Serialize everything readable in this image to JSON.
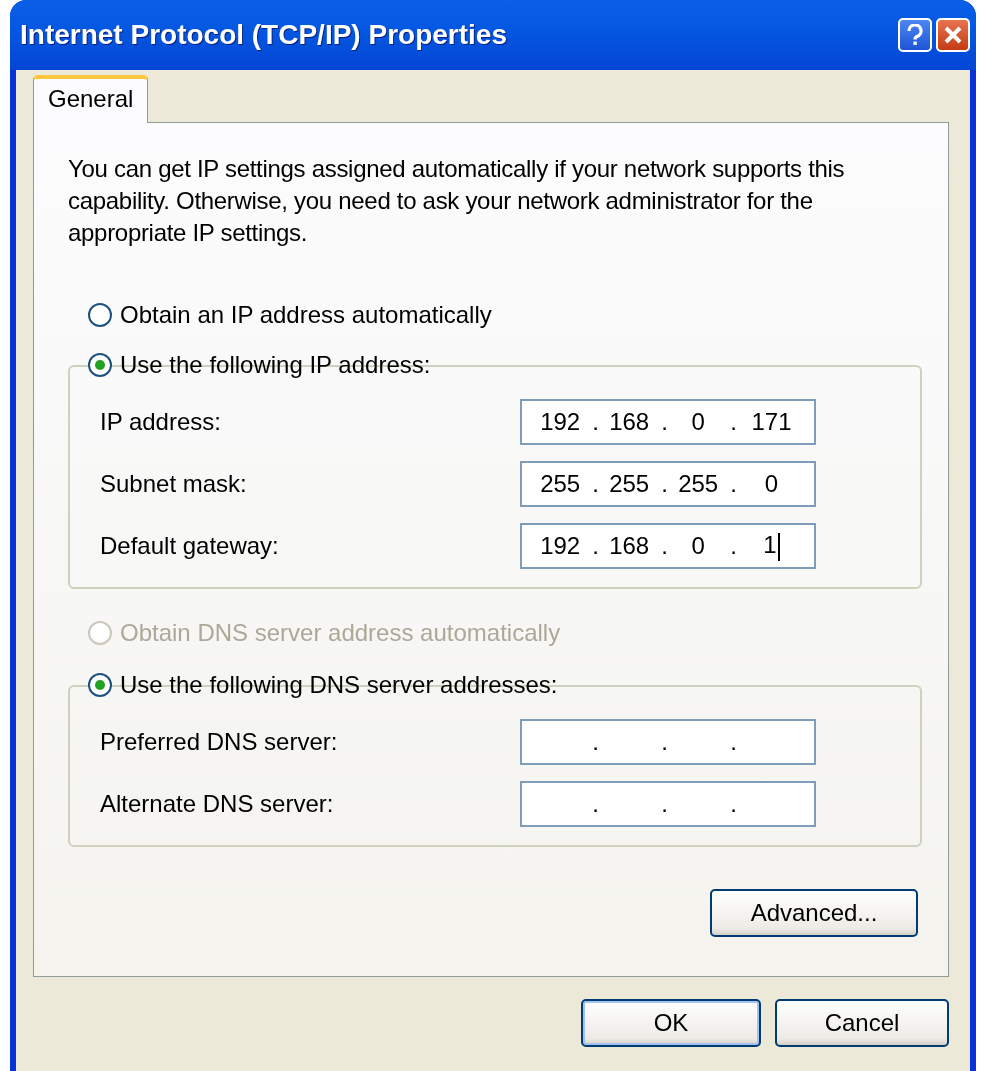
{
  "window": {
    "title": "Internet Protocol (TCP/IP) Properties"
  },
  "tabs": [
    {
      "label": "General",
      "selected": true
    }
  ],
  "intro": "You can get IP settings assigned automatically if your network supports this capability. Otherwise, you need to ask your network administrator for the appropriate IP settings.",
  "ip_options": [
    {
      "label": "Obtain an IP address automatically",
      "selected": false,
      "disabled": false
    },
    {
      "label": "Use the following IP address:",
      "selected": true,
      "disabled": false
    }
  ],
  "ip_fields": [
    {
      "label": "IP address:",
      "octets": [
        "192",
        "168",
        "0",
        "171"
      ],
      "dots": [
        ".",
        ".",
        "."
      ],
      "focused": false
    },
    {
      "label": "Subnet mask:",
      "octets": [
        "255",
        "255",
        "255",
        "0"
      ],
      "dots": [
        ".",
        ".",
        "."
      ],
      "focused": false
    },
    {
      "label": "Default gateway:",
      "octets": [
        "192",
        "168",
        "0",
        "1"
      ],
      "dots": [
        ".",
        ".",
        "."
      ],
      "focused": true
    }
  ],
  "dns_options": [
    {
      "label": "Obtain DNS server address automatically",
      "selected": false,
      "disabled": true
    },
    {
      "label": "Use the following DNS server addresses:",
      "selected": true,
      "disabled": false
    }
  ],
  "dns_fields": [
    {
      "label": "Preferred DNS server:",
      "dots": [
        ".",
        ".",
        "."
      ],
      "focused": false
    },
    {
      "label": "Alternate DNS server:",
      "dots": [
        ".",
        ".",
        "."
      ],
      "focused": false
    }
  ],
  "advanced_button": {
    "label": "Advanced..."
  },
  "buttons": [
    {
      "label": "OK",
      "default": true
    },
    {
      "label": "Cancel",
      "default": false
    }
  ]
}
